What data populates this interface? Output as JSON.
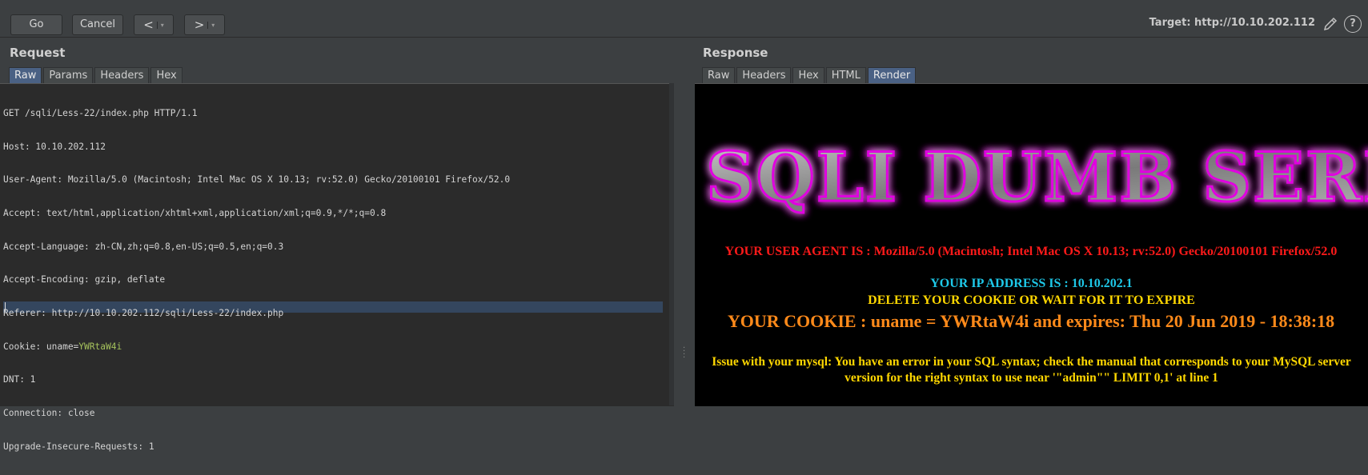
{
  "toolbar": {
    "go_label": "Go",
    "cancel_label": "Cancel",
    "back_label": "<",
    "forward_label": ">",
    "dropdown_caret": "▾",
    "target_text": "Target: http://10.10.202.112",
    "help_label": "?"
  },
  "request": {
    "title": "Request",
    "tabs": [
      "Raw",
      "Params",
      "Headers",
      "Hex"
    ],
    "active_tab": "Raw",
    "lines": [
      "GET /sqli/Less-22/index.php HTTP/1.1",
      "Host: 10.10.202.112",
      "User-Agent: Mozilla/5.0 (Macintosh; Intel Mac OS X 10.13; rv:52.0) Gecko/20100101 Firefox/52.0",
      "Accept: text/html,application/xhtml+xml,application/xml;q=0.9,*/*;q=0.8",
      "Accept-Language: zh-CN,zh;q=0.8,en-US;q=0.5,en;q=0.3",
      "Accept-Encoding: gzip, deflate",
      "Referer: http://10.10.202.112/sqli/Less-22/index.php"
    ],
    "cookie_prefix": "Cookie: uname=",
    "cookie_value": "YWRtaW4i",
    "lines_after": [
      "DNT: 1",
      "Connection: close",
      "Upgrade-Insecure-Requests: 1"
    ]
  },
  "response": {
    "title": "Response",
    "tabs": [
      "Raw",
      "Headers",
      "Hex",
      "HTML",
      "Render"
    ],
    "active_tab": "Render",
    "banner_text": "SQLI DUMB SERI",
    "user_agent_line": "YOUR USER AGENT IS : Mozilla/5.0 (Macintosh; Intel Mac OS X 10.13; rv:52.0) Gecko/20100101 Firefox/52.0",
    "ip_line": "YOUR IP ADDRESS IS : 10.10.202.1",
    "delete_line": "DELETE YOUR COOKIE OR WAIT FOR IT TO EXPIRE",
    "cookie_line": "YOUR COOKIE : uname = YWRtaW4i and expires: Thu 20 Jun 2019 - 18:38:18",
    "error_line": "Issue with your mysql: You have an error in your SQL syntax; check the manual that corresponds to your MySQL server version for the right syntax to use near '\"admin\"\" LIMIT 0,1' at line 1"
  },
  "colors": {
    "background": "#3c3f41",
    "editor_bg": "#2b2b2b",
    "active_tab": "#4a6184",
    "cookie_value": "#a5c25c",
    "ua_red": "#ff1a1a",
    "ip_cyan": "#1ec8e8",
    "yellow": "#ffd700",
    "cookie_orange": "#ff8a1a",
    "banner_glow": "#d400d4"
  }
}
